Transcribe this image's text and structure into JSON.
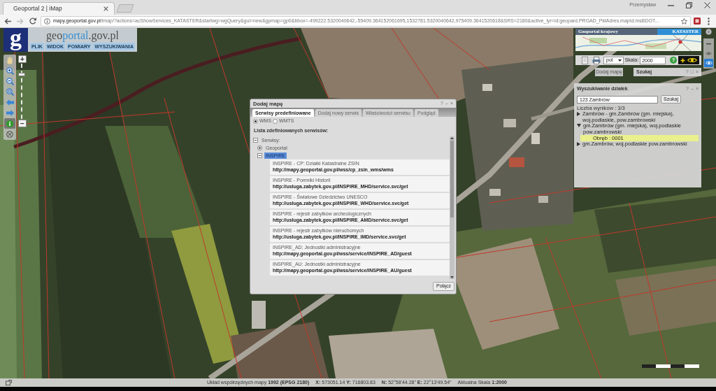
{
  "browser": {
    "tab_title": "Geoportal 2 | iMap",
    "user": "Przemysław",
    "url_host": "mapy.geoportal.gov.pl",
    "url_path": "/imap/?actions=acShowServices_KATASTER&startwg=wgQuery&gui=new&gpmap=gp0&bbox=-499222.5320040642,-55409.364152061695,1532781.5320040642,975409.3641520618&SRS=2180&active_lyr=id:geopard.PRGAD_PktAdres.mapId:msBDOT..."
  },
  "logo": {
    "letter": "g",
    "brand_parts": [
      {
        "text": "geo",
        "kind": "plain"
      },
      {
        "text": "portal",
        "kind": "accent"
      },
      {
        "text": ".gov.pl",
        "kind": "plain"
      }
    ]
  },
  "menu": [
    "PLIK",
    "WIDOK",
    "POMIARY",
    "WYSZUKIWANIA"
  ],
  "map_tools": [
    {
      "kind": "pan",
      "selected": false
    },
    {
      "kind": "zoom_in",
      "selected": false
    },
    {
      "kind": "zoom_out",
      "selected": false
    },
    {
      "kind": "zoom_box",
      "selected": false
    },
    {
      "kind": "back",
      "selected": false
    },
    {
      "kind": "forward",
      "selected": false
    },
    {
      "kind": "info",
      "selected": true
    },
    {
      "kind": "wheel",
      "selected": false
    }
  ],
  "zoom_slider": {
    "plus": "+",
    "minus": "−",
    "level": 0.82
  },
  "dialog": {
    "title": "Dodaj mapę",
    "controls": [
      "?",
      "–",
      "×"
    ],
    "tabs": [
      {
        "label": "Serwisy predefiniowane",
        "selected": true
      },
      {
        "label": "Dodaj nowy serwis",
        "selected": false
      },
      {
        "label": "Właściwości serwisu",
        "selected": false
      },
      {
        "label": "Podgląd",
        "selected": false
      }
    ],
    "protocols": [
      {
        "label": "WMS",
        "selected": true
      },
      {
        "label": "WMTS",
        "selected": false
      }
    ],
    "list_title": "Lista zdefiniowanych serwisów:",
    "tree": [
      {
        "kind": "folder",
        "label": "Serwisy:",
        "expanded": true,
        "selected": false,
        "children": [
          {
            "kind": "folder",
            "label": "Geoportal",
            "expanded": false,
            "selected": false
          },
          {
            "kind": "folder",
            "label": "INSPIRE",
            "expanded": true,
            "selected": true,
            "children": [
              {
                "kind": "service",
                "title": "INSPIRE - CP: Działki Katastralne ZSIN",
                "url": "http://mapy.geoportal.gov.pl/wss/cp_zsin_wms/wms",
                "selected": false
              },
              {
                "kind": "service",
                "title": "INSPIRE - Pomniki Historii",
                "url": "http://usluga.zabytek.gov.pl/INSPIRE_MHD/service.svc/get",
                "selected": false
              },
              {
                "kind": "service",
                "title": "INSPIRE - Światowe Dziedzictwo UNESCO",
                "url": "http://usluga.zabytek.gov.pl/INSPIRE_WHD/service.svc/get",
                "selected": false
              },
              {
                "kind": "service",
                "title": "INSPIRE - rejestr zabytków archeologicznych",
                "url": "http://usluga.zabytek.gov.pl/INSPIRE_AMD/service.svc/get",
                "selected": false
              },
              {
                "kind": "service",
                "title": "INSPIRE - rejestr zabytków nieruchomych",
                "url": "http://usluga.zabytek.gov.pl/INSPIRE_IMD/service.svc/get",
                "selected": false
              },
              {
                "kind": "service",
                "title": "INSPIRE_AD: Jednostki administracyjne",
                "url": "http://mapy.geoportal.gov.pl/wss/service/INSPIRE_AD/guest",
                "selected": false
              },
              {
                "kind": "service",
                "title": "INSPIRE_AU: Jednostki administracyjne",
                "url": "http://mapy.geoportal.gov.pl/wss/service/INSPIRE_AU/guest",
                "selected": false
              }
            ]
          }
        ]
      }
    ],
    "connect_button": "Połącz"
  },
  "overview": {
    "title": "Geoportal krajowy",
    "badge": "KATASTER"
  },
  "toolbar": {
    "language": "pol",
    "scale_label": "Skala:",
    "scale_value": "2000",
    "help": "?"
  },
  "add_map_button": {
    "label": "Dodaj mapę",
    "disabled": true
  },
  "search_tab": {
    "title": "Szukaj",
    "controls": [
      "?",
      "□",
      "×"
    ]
  },
  "search_panel": {
    "title": "Wyszukiwanie działek",
    "controls": [
      "?",
      "–",
      "×"
    ],
    "query": "123 Zambrów",
    "button": "Szukaj",
    "count": "Liczba wyników : 3/3",
    "results": [
      {
        "label": "Zambrów - gm.Zambrów (gm. miejska), woj.podlaskie, pow.zambrowski",
        "expanded": false,
        "selected": false
      },
      {
        "label": "gm.Zambrów (gm. miejska), woj.podlaskie pow.zambrowski",
        "expanded": true,
        "selected": false,
        "children": [
          {
            "label": "Obręb : 0001",
            "selected": true
          }
        ]
      },
      {
        "label": "gm.Zambrów, woj.podlaskie pow.zambrowski",
        "expanded": false,
        "selected": false
      }
    ]
  },
  "status_bar": {
    "items": [
      "Układ współrzędnych mapy **1992 (EPSG 2180)**",
      "**X:** 573051.14 **Y:** 716803.83",
      "**N:** 52°58'44.28\" **E:** 22°13'49.54\"",
      "Aktualna Skala **1:2000**"
    ]
  }
}
